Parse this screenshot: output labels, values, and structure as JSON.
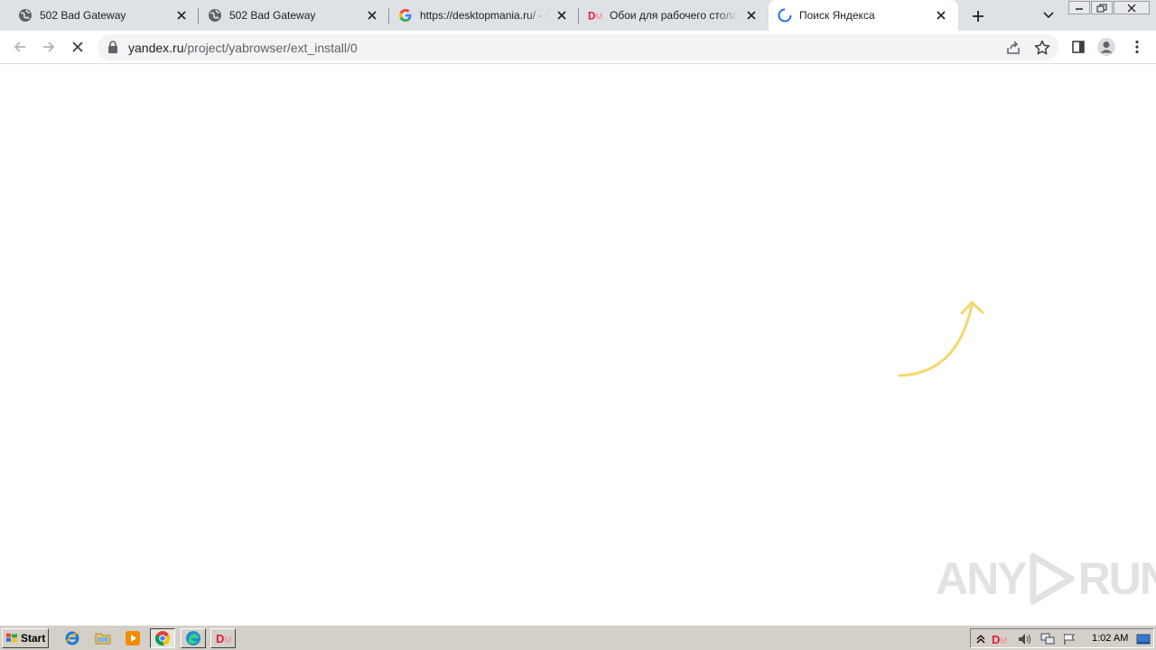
{
  "tabs": [
    {
      "title": "502 Bad Gateway",
      "icon": "globe-icon",
      "active": false
    },
    {
      "title": "502 Bad Gateway",
      "icon": "globe-icon",
      "active": false
    },
    {
      "title": "https://desktopmania.ru/ - Google",
      "icon": "google-icon",
      "active": false
    },
    {
      "title": "Обои для рабочего стола. Скачать",
      "icon": "desktopmania-icon",
      "active": false
    },
    {
      "title": "Поиск Яндекса",
      "icon": "loading-spinner-icon",
      "active": true
    }
  ],
  "address_bar": {
    "domain": "yandex.ru",
    "path": "/project/yabrowser/ext_install/0"
  },
  "watermark": {
    "left": "ANY",
    "right": "RUN"
  },
  "taskbar": {
    "start_label": "Start",
    "quick_launch": [
      "ie-icon",
      "folder-icon",
      "media-player-icon",
      "chrome-icon",
      "edge-icon",
      "desktopmania-icon"
    ],
    "tray_icons": [
      "show-hidden-icons-icon",
      "desktopmania-icon",
      "volume-icon",
      "network-icon",
      "action-center-flag-icon"
    ],
    "clock": "1:02 AM"
  },
  "colors": {
    "tab_strip": "#dee1e6",
    "omnibox": "#f1f3f4",
    "arrow": "#f5d76e",
    "desktopmania_brand": "#e8173a",
    "taskbar": "#d4d0c8"
  }
}
